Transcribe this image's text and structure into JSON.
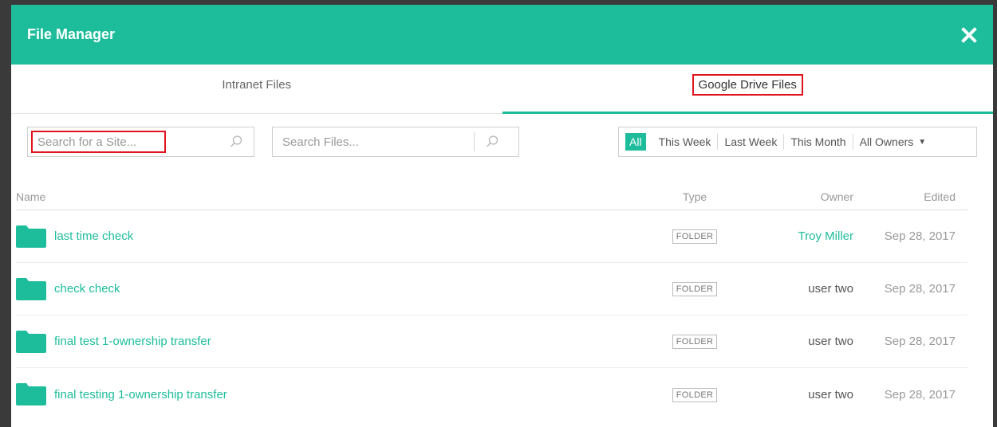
{
  "modal": {
    "title": "File Manager"
  },
  "tabs": [
    {
      "label": "Intranet Files",
      "active": false
    },
    {
      "label": "Google Drive Files",
      "active": true
    }
  ],
  "search": {
    "site_placeholder": "Search for a Site...",
    "files_placeholder": "Search Files..."
  },
  "filters": {
    "items": [
      "All",
      "This Week",
      "Last Week",
      "This Month"
    ],
    "active": "All",
    "owners_label": "All Owners"
  },
  "table": {
    "headers": {
      "name": "Name",
      "type": "Type",
      "owner": "Owner",
      "edited": "Edited"
    },
    "rows": [
      {
        "name": "last time check",
        "type": "FOLDER",
        "owner": "Troy Miller",
        "edited": "Sep 28, 2017"
      },
      {
        "name": "check check",
        "type": "FOLDER",
        "owner": "user two",
        "edited": "Sep 28, 2017"
      },
      {
        "name": "final test 1-ownership transfer",
        "type": "FOLDER",
        "owner": "user two",
        "edited": "Sep 28, 2017"
      },
      {
        "name": "final testing 1-ownership transfer",
        "type": "FOLDER",
        "owner": "user two",
        "edited": "Sep 28, 2017"
      }
    ]
  },
  "colors": {
    "accent": "#1dbd9c",
    "highlight": "#e0141e"
  },
  "icons": {
    "close": "close-icon",
    "search": "search-icon",
    "folder": "folder-icon",
    "dropdown": "caret-down-icon"
  }
}
